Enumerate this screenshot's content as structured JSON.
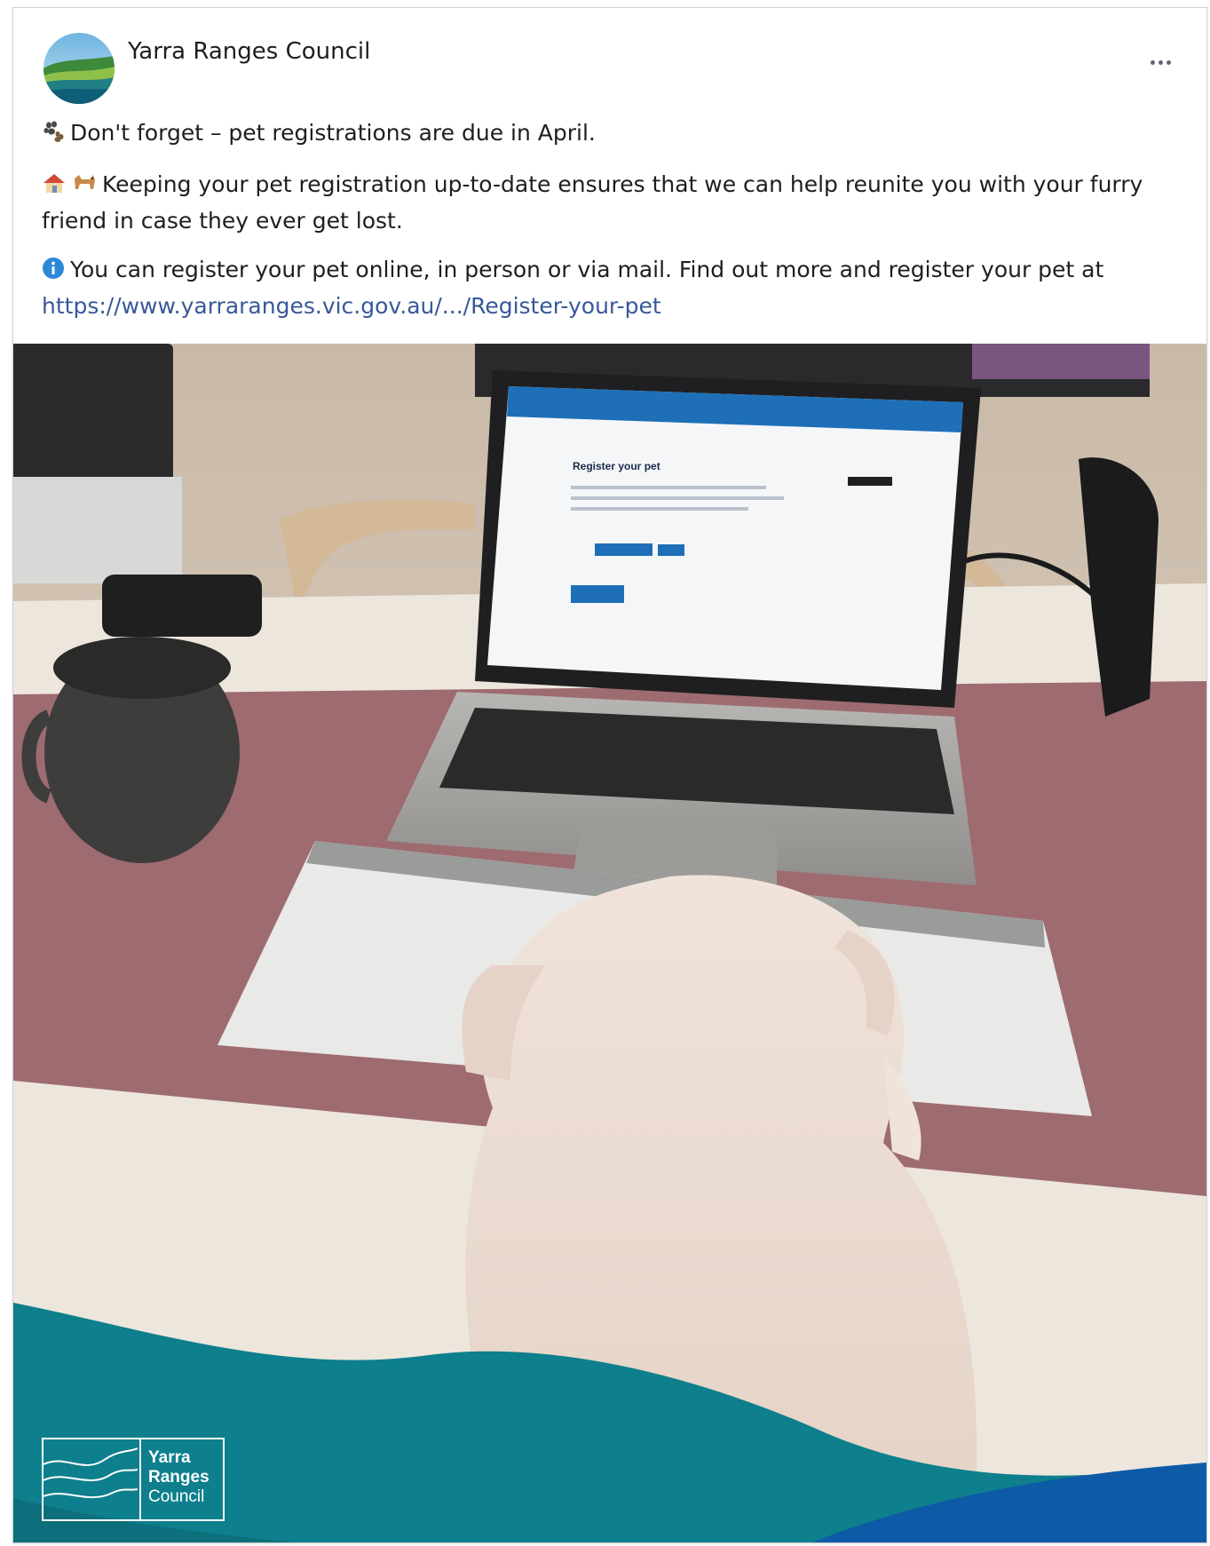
{
  "post": {
    "author": "Yarra Ranges Council",
    "more_icon": "more-options-icon",
    "paragraphs": [
      {
        "icon": "paw-prints-icon",
        "text": "Don't forget – pet registrations are due in April."
      },
      {
        "icon": "house-dog-icon",
        "text": "Keeping your pet registration up-to-date ensures that we can help reunite you with your furry friend in case they ever get lost."
      },
      {
        "icon": "info-icon",
        "text": "You can register your pet online, in person or via mail. Find out more and register your pet at",
        "link": "https://www.yarraranges.vic.gov.au/.../Register-your-pet"
      }
    ]
  },
  "photo": {
    "laptop_screen_heading": "Register your pet",
    "logo_lines": [
      "Yarra",
      "Ranges",
      "Council"
    ]
  },
  "colors": {
    "link": "#385898",
    "banner_teal": "#0e7f8c",
    "banner_blue": "#0d5aa7",
    "desk_mat": "#9e6b70"
  }
}
